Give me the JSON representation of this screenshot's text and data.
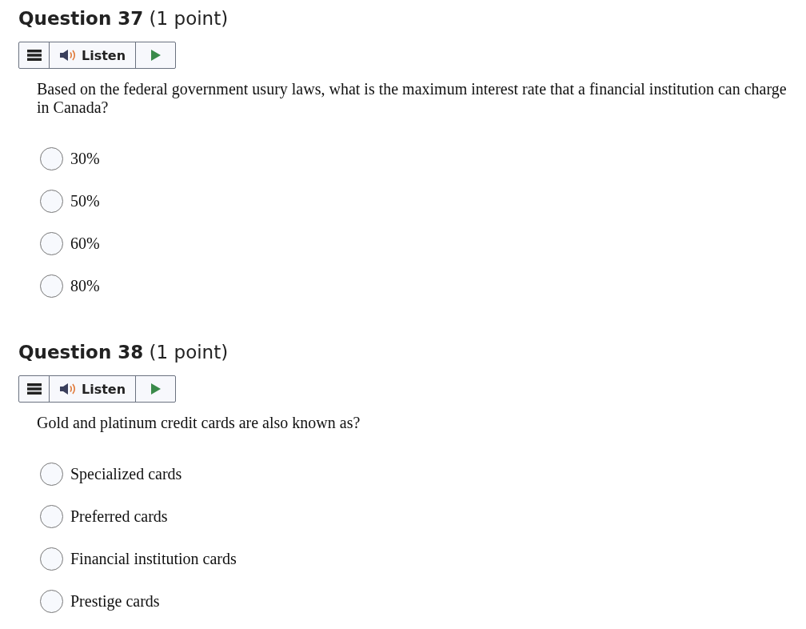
{
  "questions": [
    {
      "title": "**Question 37** (1 point)",
      "listen": "Listen",
      "text": "Based on the federal government usury laws, what is the maximum interest rate that a financial institution can charge in Canada?",
      "options": [
        {
          "label": "30%",
          "selected": false
        },
        {
          "label": "50%",
          "selected": false
        },
        {
          "label": "60%",
          "selected": false
        },
        {
          "label": "80%",
          "selected": false
        }
      ]
    },
    {
      "title": "**Question 38** (1 point)",
      "listen": "Listen",
      "text": "Gold and platinum credit cards are also known as?",
      "options": [
        {
          "label": "Specialized cards",
          "selected": false
        },
        {
          "label": "Preferred cards",
          "selected": false
        },
        {
          "label": "Financial institution cards",
          "selected": false
        },
        {
          "label": "Prestige cards",
          "selected": false
        }
      ]
    }
  ]
}
